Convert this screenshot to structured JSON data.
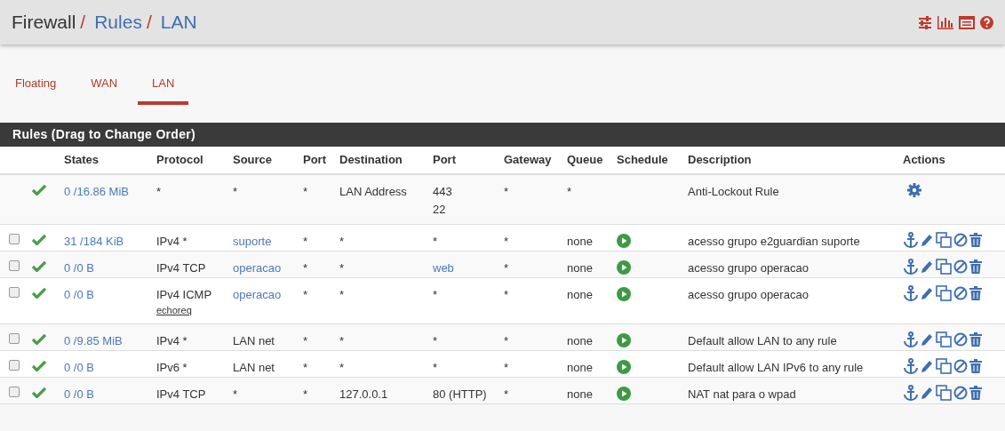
{
  "breadcrumb": [
    {
      "label": "Firewall",
      "link": false,
      "separator": "/"
    },
    {
      "label": "Rules",
      "link": true,
      "separator": "/"
    },
    {
      "label": "LAN",
      "link": true
    }
  ],
  "tabs": [
    {
      "label": "Floating",
      "selected": false
    },
    {
      "label": "WAN",
      "selected": false
    },
    {
      "label": "LAN",
      "selected": true
    }
  ],
  "panel_title": "Rules (Drag to Change Order)",
  "columns": [
    "States",
    "Protocol",
    "Source",
    "Port",
    "Destination",
    "Port",
    "Gateway",
    "Queue",
    "Schedule",
    "Description",
    "Actions"
  ],
  "rows": [
    {
      "has_checkbox": false,
      "enabled": true,
      "states": "0 /16.86 MiB",
      "protocol": [
        "*"
      ],
      "source": {
        "text": "*",
        "link": false
      },
      "source_port": "*",
      "destination": "LAN Address",
      "destination_port": {
        "text": "443\n22",
        "link": false
      },
      "gateway": "*",
      "queue": "*",
      "schedule": false,
      "description": "Anti-Lockout Rule",
      "kind": "system"
    },
    {
      "has_checkbox": true,
      "checked": false,
      "enabled": true,
      "states": "31 /184 KiB",
      "protocol": [
        "IPv4 *"
      ],
      "source": {
        "text": "suporte",
        "link": true
      },
      "source_port": "*",
      "destination": "*",
      "destination_port": {
        "text": "*",
        "link": false
      },
      "gateway": "*",
      "queue": "none",
      "schedule": true,
      "description": "acesso grupo e2guardian suporte",
      "kind": "user"
    },
    {
      "has_checkbox": true,
      "checked": false,
      "enabled": true,
      "states": "0 /0 B",
      "protocol": [
        "IPv4 TCP"
      ],
      "source": {
        "text": "operacao",
        "link": true
      },
      "source_port": "*",
      "destination": "*",
      "destination_port": {
        "text": "web",
        "link": true
      },
      "gateway": "*",
      "queue": "none",
      "schedule": true,
      "description": "acesso grupo operacao",
      "kind": "user"
    },
    {
      "has_checkbox": true,
      "checked": false,
      "enabled": true,
      "states": "0 /0 B",
      "protocol": [
        "IPv4 ICMP",
        "echoreq"
      ],
      "source": {
        "text": "operacao",
        "link": true
      },
      "source_port": "*",
      "destination": "*",
      "destination_port": {
        "text": "*",
        "link": false
      },
      "gateway": "*",
      "queue": "none",
      "schedule": true,
      "description": "acesso grupo operacao",
      "kind": "user"
    },
    {
      "has_checkbox": true,
      "checked": false,
      "enabled": true,
      "states": "0 /9.85 MiB",
      "protocol": [
        "IPv4 *"
      ],
      "source": {
        "text": "LAN net",
        "link": false
      },
      "source_port": "*",
      "destination": "*",
      "destination_port": {
        "text": "*",
        "link": false
      },
      "gateway": "*",
      "queue": "none",
      "schedule": true,
      "description": "Default allow LAN to any rule",
      "kind": "user"
    },
    {
      "has_checkbox": true,
      "checked": false,
      "enabled": true,
      "states": "0 /0 B",
      "protocol": [
        "IPv6 *"
      ],
      "source": {
        "text": "LAN net",
        "link": false
      },
      "source_port": "*",
      "destination": "*",
      "destination_port": {
        "text": "*",
        "link": false
      },
      "gateway": "*",
      "queue": "none",
      "schedule": true,
      "description": "Default allow LAN IPv6 to any rule",
      "kind": "user"
    },
    {
      "has_checkbox": true,
      "checked": false,
      "enabled": true,
      "states": "0 /0 B",
      "protocol": [
        "IPv4 TCP"
      ],
      "source": {
        "text": "*",
        "link": false
      },
      "source_port": "*",
      "destination": "127.0.0.1",
      "destination_port": {
        "text": "80 (HTTP)",
        "link": false
      },
      "gateway": "*",
      "queue": "none",
      "schedule": true,
      "description": "NAT nat para o wpad",
      "kind": "user"
    }
  ]
}
